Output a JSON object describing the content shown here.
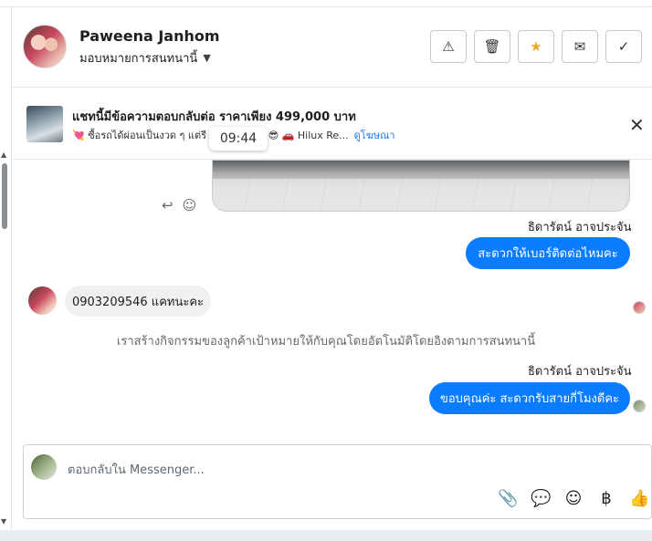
{
  "header": {
    "contact_name": "Paweena Janhom",
    "assign_label": "มอบหมายการสนทนานี้",
    "actions": [
      {
        "icon": "warning-icon",
        "glyph": "⚠"
      },
      {
        "icon": "trash-icon",
        "glyph": "🗑"
      },
      {
        "icon": "star-icon",
        "glyph": "★"
      },
      {
        "icon": "envelope-icon",
        "glyph": "✉"
      },
      {
        "icon": "check-icon",
        "glyph": "✓"
      }
    ]
  },
  "ad": {
    "title": "แชทนี้มีข้อความตอบกลับต่อ ราคาเพียง 499,000 บาท",
    "subtitle": "💘 ซื้อรถได้ผ่อนเป็นงวด ๆ แต่รี อดชีวิตได้นะ 😎 🚗 Hilux Re...",
    "link": "ดูโฆษณา",
    "close_glyph": "✕"
  },
  "time_badge": "09:44",
  "conversation": {
    "sender_1": "ธิดารัตน์ อาจประจัน",
    "msg_1": "สะดวกให้เบอร์ติดต่อไหมคะ",
    "incoming_msg": "0903209546 แคทนะคะ",
    "system_msg": "เราสร้างกิจกรรมของลูกค้าเป้าหมายให้กับคุณโดยอัตโนมัติโดยอิงตามการสนทนานี้",
    "sender_2": "ธิดารัตน์ อาจประจัน",
    "msg_2": "ขอบคุณค่ะ สะดวกรับสายกี่โมงดีคะ"
  },
  "composer": {
    "placeholder": "ตอบกลับใน Messenger...",
    "tools": [
      {
        "icon": "paperclip-icon",
        "glyph": "📎"
      },
      {
        "icon": "chat-bubble-icon",
        "glyph": "💬"
      },
      {
        "icon": "emoji-icon",
        "glyph": "☺"
      },
      {
        "icon": "baht-icon",
        "glyph": "฿"
      },
      {
        "icon": "thumbs-up-icon",
        "glyph": "👍"
      }
    ]
  }
}
